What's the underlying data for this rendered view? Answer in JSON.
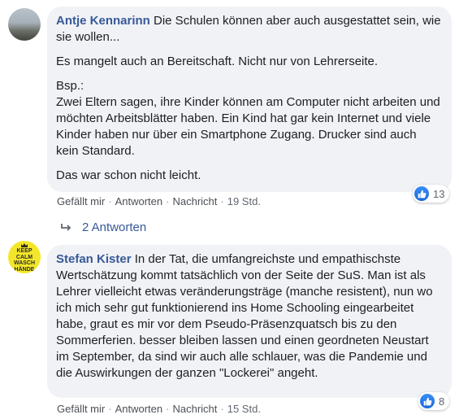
{
  "comments": [
    {
      "author": "Antje Kennarinn",
      "first_line": " Die Schulen können aber auch ausgestattet sein, wie sie wollen...",
      "paragraphs": [
        "Es mangelt auch an Bereitschaft. Nicht nur von Lehrerseite.",
        "Bsp.:\nZwei Eltern sagen, ihre Kinder können am Computer nicht arbeiten und möchten Arbeitsblätter haben. Ein Kind hat gar kein Internet und viele Kinder haben nur über ein Smartphone Zugang. Drucker sind auch kein Standard.",
        "Das war schon nicht leicht."
      ],
      "like": "Gefällt mir",
      "reply": "Antworten",
      "message": "Nachricht",
      "time": "19 Std.",
      "reactions": "13"
    },
    {
      "author": "Stefan Kister",
      "first_line": " In der Tat, die umfangreichste und empathischste Wertschätzung kommt tatsächlich von der Seite der SuS. Man ist als Lehrer vielleicht etwas veränderungsträge (manche resistent), nun wo ich mich sehr gut funktionierend ins Home Schooling eingearbeitet habe, graut es mir vor dem Pseudo-Präsenzquatsch bis zu den Sommerferien. besser bleiben lassen und einen geordneten Neustart im September, da sind wir auch alle schlauer, was die Pandemie und die Auswirkungen der ganzen \"Lockerei\" angeht.",
      "like": "Gefällt mir",
      "reply": "Antworten",
      "message": "Nachricht",
      "time": "15 Std.",
      "reactions": "8",
      "avatar_text": "KEEP CALM AND WASCH HÄNDE"
    }
  ],
  "replies_link": "2 Antworten",
  "sep": "·",
  "colors": {
    "link": "#385898",
    "bubble": "#f0f2f5",
    "like": "#1877f2"
  },
  "icons": {
    "reply_arrow": "reply-arrow-icon",
    "like": "thumbs-up-icon"
  }
}
